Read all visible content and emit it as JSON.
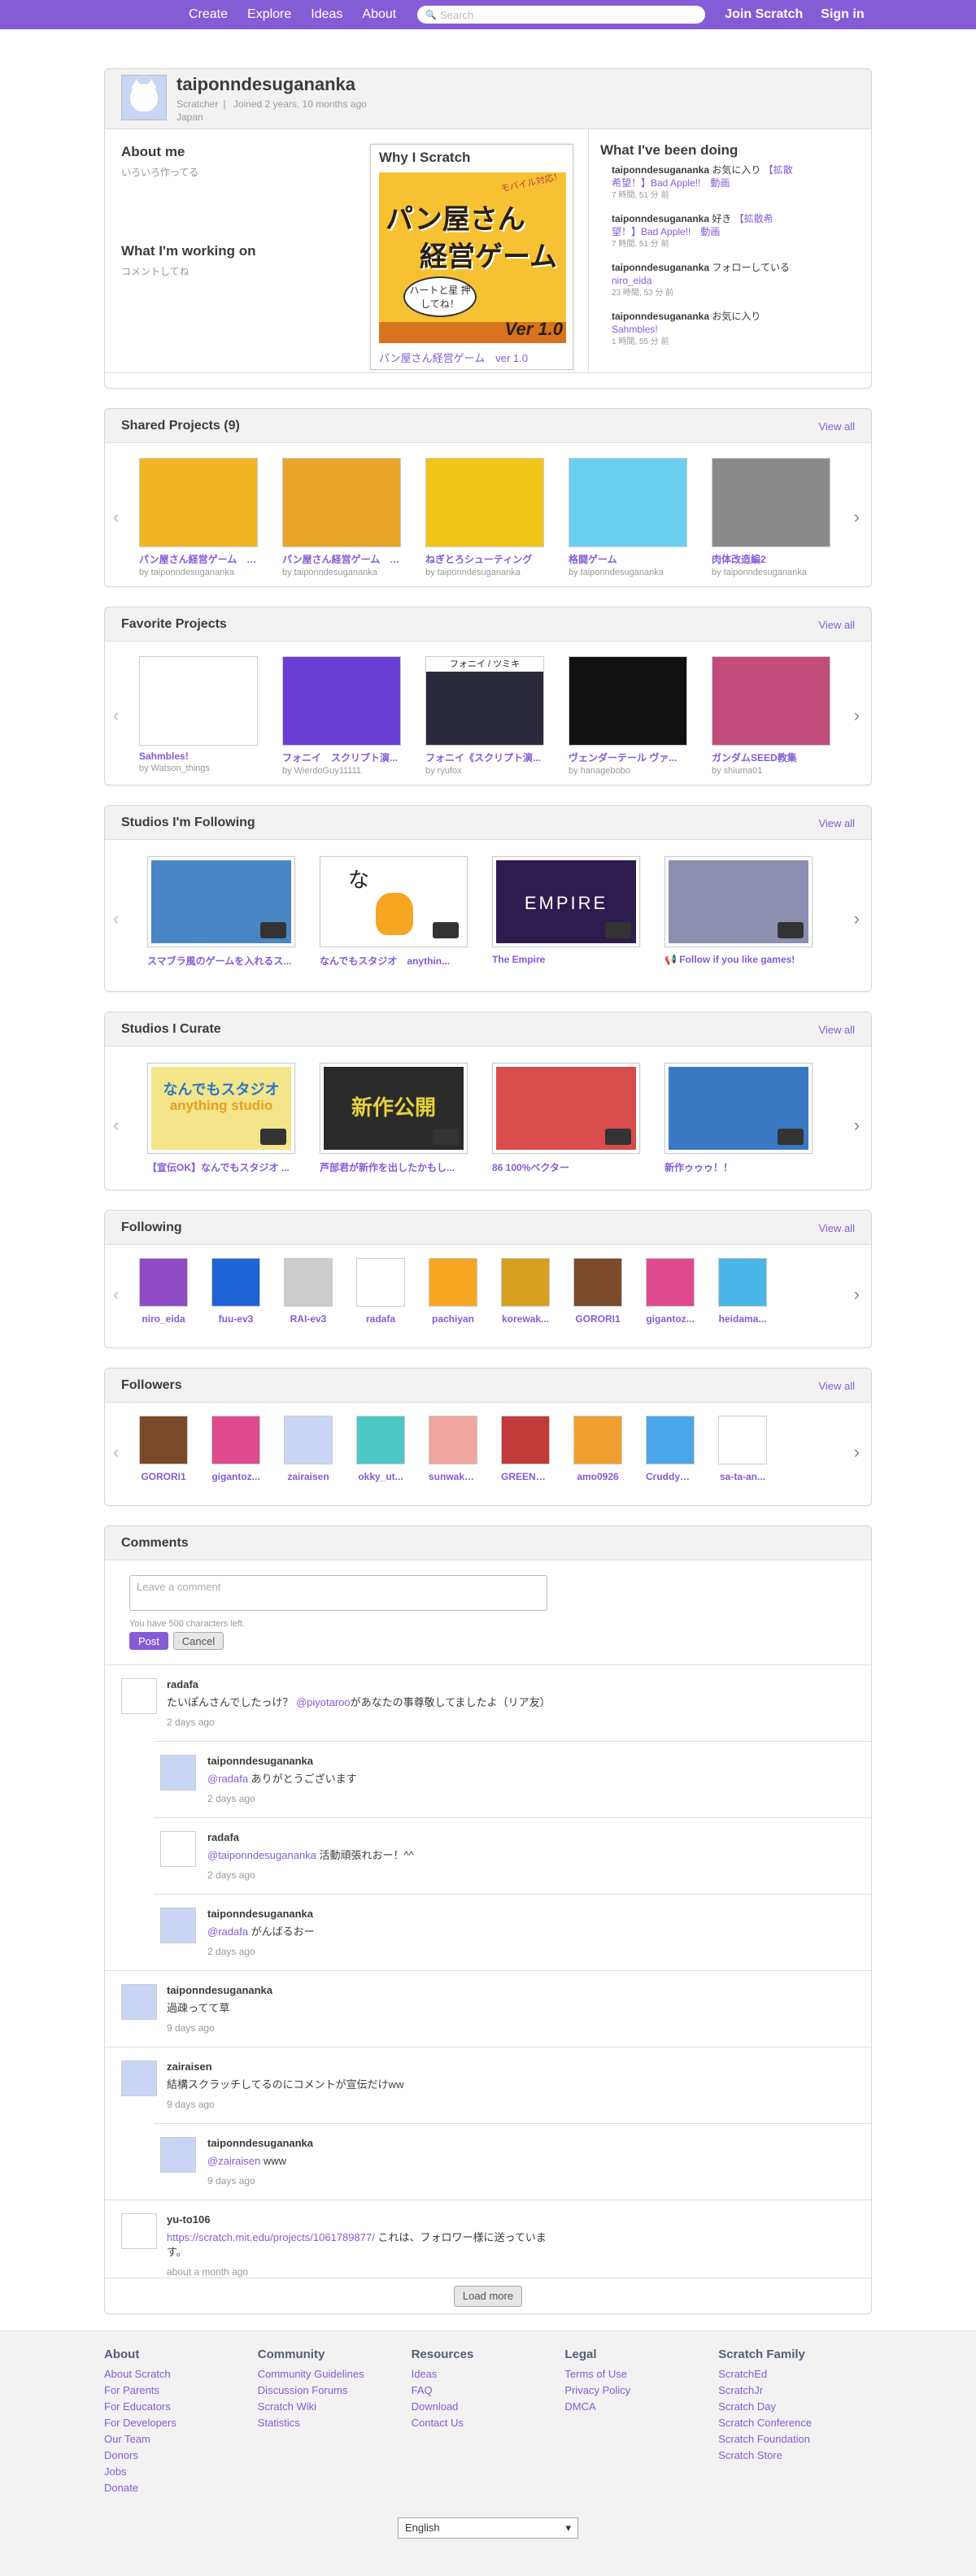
{
  "nav": {
    "links": [
      "Create",
      "Explore",
      "Ideas",
      "About"
    ],
    "search_placeholder": "Search",
    "join": "Join Scratch",
    "signin": "Sign in"
  },
  "profile": {
    "username": "taiponndesugananka",
    "role": "Scratcher",
    "joined": "Joined 2 years, 10 months ago",
    "location": "Japan",
    "about_title": "About me",
    "about_text": "いろいろ作ってる",
    "working_title": "What I'm working on",
    "working_text": "コメントしてね",
    "why_title": "Why I Scratch",
    "featured_caption": "パン屋さん経営ゲーム　ver 1.0",
    "featured_art": {
      "line1": "パン屋さん",
      "line2": "経営ゲーム",
      "tag": "モバイル対応！",
      "bubble": "ハートと星 押してね！",
      "version": "Ver 1.0"
    },
    "doing_title": "What I've been doing",
    "activity": [
      {
        "user": "taiponndesugananka",
        "action": "お気に入り",
        "target": "【拡散希望！】Bad Apple!!　動画",
        "time": "7 時間, 51 分 前"
      },
      {
        "user": "taiponndesugananka",
        "action": "好き",
        "target": "【拡散希望！】Bad Apple!!　動画",
        "time": "7 時間, 51 分 前"
      },
      {
        "user": "taiponndesugananka",
        "action": "フォローしている",
        "target": "niro_eida",
        "time": "23 時間, 53 分 前"
      },
      {
        "user": "taiponndesugananka",
        "action": "お気に入り",
        "target": "Sahmbles!",
        "time": "1 時間, 55 分 前"
      }
    ]
  },
  "shared": {
    "title": "Shared Projects (9)",
    "view_all": "View all",
    "items": [
      {
        "title": "パン屋さん経営ゲーム　ver...",
        "by": "by taiponndesugananka",
        "color": "#f2b624"
      },
      {
        "title": "パン屋さん経営ゲーム　ver...",
        "by": "by taiponndesugananka",
        "color": "#e8a72a"
      },
      {
        "title": "ねぎとろシューティング",
        "by": "by taiponndesugananka",
        "color": "#f0c419"
      },
      {
        "title": "格闘ゲーム",
        "by": "by taiponndesugananka",
        "color": "#6ad0f2"
      },
      {
        "title": "肉体改造編2",
        "by": "by taiponndesugananka",
        "color": "#8a8a8a"
      }
    ]
  },
  "favorites": {
    "title": "Favorite Projects",
    "view_all": "View all",
    "items": [
      {
        "title": "Sahmbles!",
        "by": "by Watson_things",
        "color": "#ffffff"
      },
      {
        "title": "フォニイ　スクリプト演...",
        "by": "by WierdoGuy11111",
        "color": "#6a3fd6"
      },
      {
        "title": "フォニイ《スクリプト演...",
        "by": "by ryufox",
        "color": "#2a2a3a"
      },
      {
        "title": "ヴェンダーテール ヴァ...",
        "by": "by hanagebobo",
        "color": "#111111"
      },
      {
        "title": "ガンダムSEED教集",
        "by": "by shiuma01",
        "color": "#c34d7a"
      }
    ],
    "fav3_caption": "フォニイ / ツミキ"
  },
  "following_studios": {
    "title": "Studios I'm Following",
    "view_all": "View all",
    "items": [
      {
        "title": "スマブラ風のゲームを入れるス...",
        "color": "#4a86c5"
      },
      {
        "title": "なんでもスタジオ　anythin...",
        "color": "#ffffff"
      },
      {
        "title": "The Empire",
        "color": "#2d1c4e"
      },
      {
        "title": "📢 Follow if you like games!",
        "color": "#8d8fb0"
      }
    ],
    "studio2_char": "な",
    "studio3_word": "EMPIRE"
  },
  "curate_studios": {
    "title": "Studios I Curate",
    "view_all": "View all",
    "items": [
      {
        "title": "【宣伝OK】なんでもスタジオ ...",
        "color": "#f4e48a"
      },
      {
        "title": "芦部君が新作を出したかもし...",
        "color": "#2a2a2a"
      },
      {
        "title": "86 100%ベクター",
        "color": "#d84c4c"
      },
      {
        "title": "新作ゥゥゥ！！",
        "color": "#3a78c4"
      }
    ],
    "studio1_line1": "なんでもスタジオ",
    "studio1_line2": "anything studio",
    "studio2_text": "新作公開"
  },
  "following": {
    "title": "Following",
    "view_all": "View all",
    "users": [
      {
        "name": "niro_eida",
        "color": "#8e4bc4"
      },
      {
        "name": "fuu-ev3",
        "color": "#1f63d6"
      },
      {
        "name": "RAI-ev3",
        "color": "#cccccc"
      },
      {
        "name": "radafa",
        "color": "#ffffff"
      },
      {
        "name": "pachiyan",
        "color": "#f6a623"
      },
      {
        "name": "korewak...",
        "color": "#d8a020"
      },
      {
        "name": "GORORI1",
        "color": "#7a4a2a"
      },
      {
        "name": "gigantoz...",
        "color": "#e04b8e"
      },
      {
        "name": "heidama...",
        "color": "#4ab6e8"
      }
    ]
  },
  "followers": {
    "title": "Followers",
    "view_all": "View all",
    "users": [
      {
        "name": "GORORI1",
        "color": "#7a4a2a"
      },
      {
        "name": "gigantoz...",
        "color": "#e04b8e"
      },
      {
        "name": "zairaisen",
        "color": "#c9d5f5"
      },
      {
        "name": "okky_ut...",
        "color": "#4ec6c4"
      },
      {
        "name": "sunwaka...",
        "color": "#f2a6a0"
      },
      {
        "name": "GREENM...",
        "color": "#c23a3a"
      },
      {
        "name": "amo0926",
        "color": "#f0a030"
      },
      {
        "name": "CruddyR...",
        "color": "#4aa6e8"
      },
      {
        "name": "sa-ta-an...",
        "color": "#ffffff"
      }
    ]
  },
  "comments": {
    "title": "Comments",
    "placeholder": "Leave a comment",
    "chars_left": "You have 500 characters left.",
    "post": "Post",
    "cancel": "Cancel",
    "load_more": "Load more",
    "list": [
      {
        "user": "radafa",
        "pre": "たいぽんさんでしたっけ？ ",
        "mention": "@piyotaroo",
        "post": "があなたの事尊敬してましたよ（リア友）",
        "time": "2 days ago",
        "reply": false,
        "color": "#ffffff"
      },
      {
        "user": "taiponndesugananka",
        "pre": "",
        "mention": "@radafa",
        "post": " ありがとうございます",
        "time": "2 days ago",
        "reply": true,
        "color": "#c9d5f5"
      },
      {
        "user": "radafa",
        "pre": "",
        "mention": "@taiponndesugananka",
        "post": " 活動頑張れおー！^^",
        "time": "2 days ago",
        "reply": true,
        "color": "#ffffff"
      },
      {
        "user": "taiponndesugananka",
        "pre": "",
        "mention": "@radafa",
        "post": " がんばるおー",
        "time": "2 days ago",
        "reply": true,
        "color": "#c9d5f5"
      },
      {
        "user": "taiponndesugananka",
        "pre": "過疎ってて草",
        "mention": "",
        "post": "",
        "time": "9 days ago",
        "reply": false,
        "color": "#c9d5f5"
      },
      {
        "user": "zairaisen",
        "pre": "結構スクラッチしてるのにコメントが宣伝だけww",
        "mention": "",
        "post": "",
        "time": "9 days ago",
        "reply": false,
        "color": "#c9d5f5"
      },
      {
        "user": "taiponndesugananka",
        "pre": "",
        "mention": "@zairaisen",
        "post": " www",
        "time": "9 days ago",
        "reply": true,
        "color": "#c9d5f5"
      },
      {
        "user": "yu-to106",
        "pre": "",
        "mention": "https://scratch.mit.edu/projects/1061789877/",
        "post": " これは、フォロワー様に送っています。",
        "time": "about a month ago",
        "reply": false,
        "color": "#ffffff"
      }
    ]
  },
  "footer": {
    "cols": [
      {
        "title": "About",
        "links": [
          "About Scratch",
          "For Parents",
          "For Educators",
          "For Developers",
          "Our Team",
          "Donors",
          "Jobs",
          "Donate"
        ]
      },
      {
        "title": "Community",
        "links": [
          "Community Guidelines",
          "Discussion Forums",
          "Scratch Wiki",
          "Statistics"
        ]
      },
      {
        "title": "Resources",
        "links": [
          "Ideas",
          "FAQ",
          "Download",
          "Contact Us"
        ]
      },
      {
        "title": "Legal",
        "links": [
          "Terms of Use",
          "Privacy Policy",
          "DMCA"
        ]
      },
      {
        "title": "Scratch Family",
        "links": [
          "ScratchEd",
          "ScratchJr",
          "Scratch Day",
          "Scratch Conference",
          "Scratch Foundation",
          "Scratch Store"
        ]
      }
    ],
    "language": "English"
  }
}
